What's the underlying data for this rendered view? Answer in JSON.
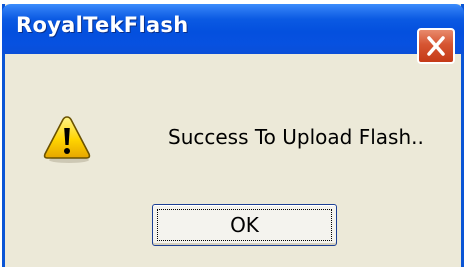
{
  "window": {
    "title": "RoyalTekFlash",
    "close_icon": "close-icon"
  },
  "dialog": {
    "icon": "warning-icon",
    "message": "Success To Upload Flash..",
    "ok_label": "OK"
  }
}
